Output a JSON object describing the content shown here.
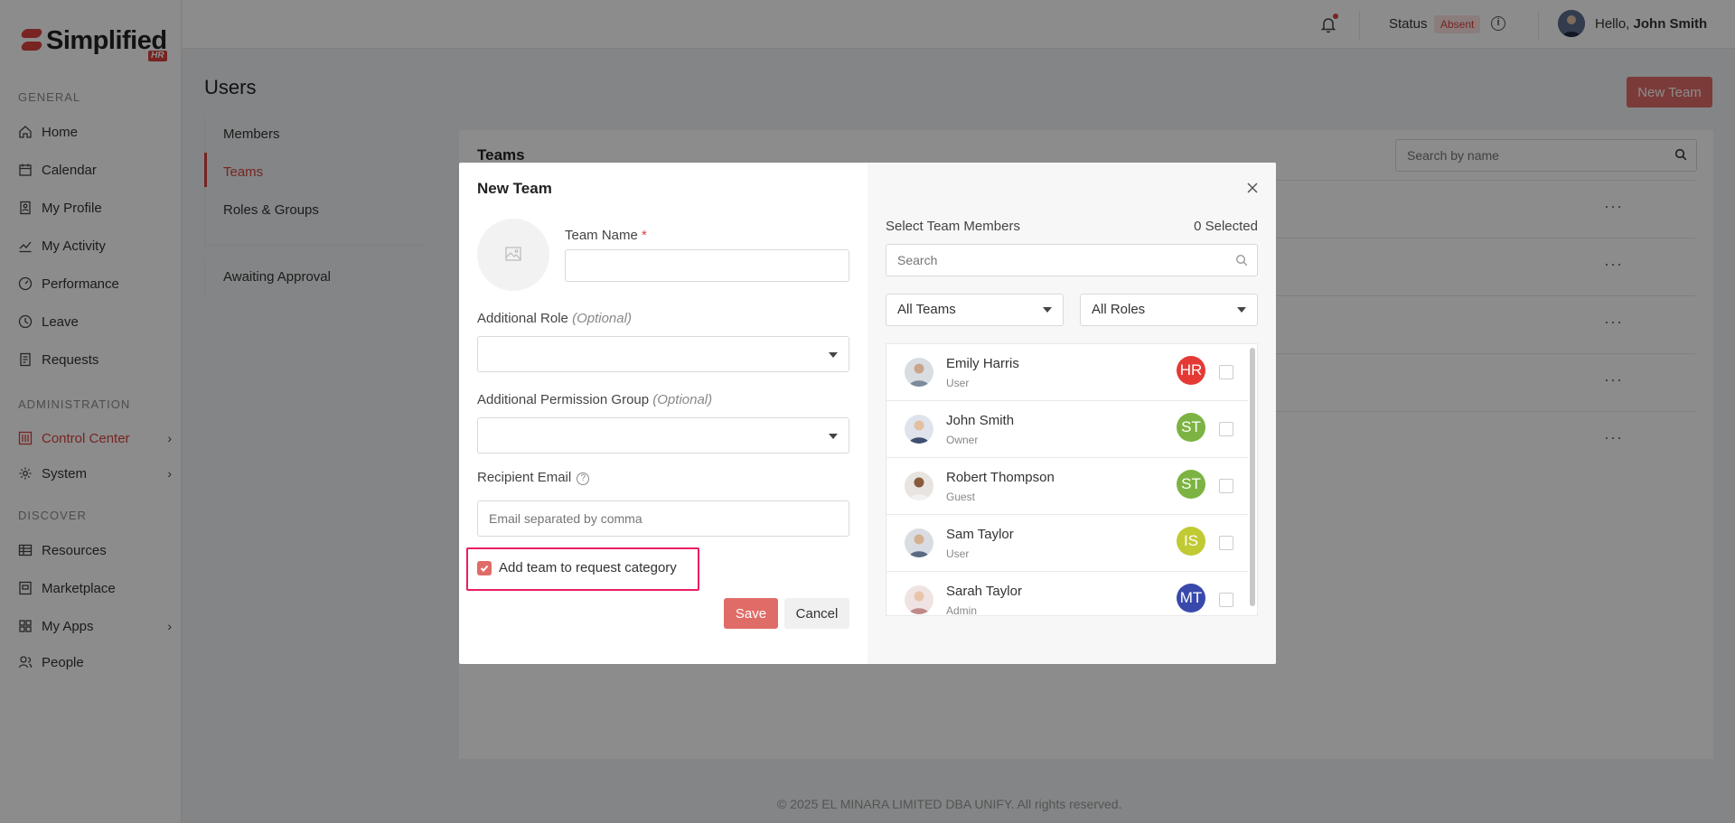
{
  "app": {
    "logo_text": "Simplified",
    "logo_badge": "HR"
  },
  "sidebar": {
    "sections": {
      "general": "GENERAL",
      "administration": "ADMINISTRATION",
      "discover": "DISCOVER"
    },
    "items": [
      {
        "label": "Home",
        "icon": "home-icon"
      },
      {
        "label": "Calendar",
        "icon": "calendar-icon"
      },
      {
        "label": "My Profile",
        "icon": "profile-icon"
      },
      {
        "label": "My Activity",
        "icon": "activity-icon"
      },
      {
        "label": "Performance",
        "icon": "gauge-icon"
      },
      {
        "label": "Leave",
        "icon": "clock-icon"
      },
      {
        "label": "Requests",
        "icon": "document-icon"
      },
      {
        "label": "Control Center",
        "icon": "control-icon",
        "active": true
      },
      {
        "label": "System",
        "icon": "gear-icon"
      },
      {
        "label": "Resources",
        "icon": "table-icon"
      },
      {
        "label": "Marketplace",
        "icon": "store-icon"
      },
      {
        "label": "My Apps",
        "icon": "apps-icon"
      },
      {
        "label": "People",
        "icon": "people-icon"
      }
    ]
  },
  "topbar": {
    "status_label": "Status",
    "status_value": "Absent",
    "greeting": "Hello,",
    "user_name": "John Smith"
  },
  "page": {
    "title": "Users",
    "new_team_button": "New Team",
    "subnav": [
      "Members",
      "Teams",
      "Roles & Groups"
    ],
    "subnav_extra": "Awaiting Approval",
    "panel_title": "Teams",
    "search_placeholder": "Search by name",
    "row_action": "···"
  },
  "footer": "© 2025 EL MINARA LIMITED DBA UNIFY. All rights reserved.",
  "modal": {
    "title": "New Team",
    "team_name_label": "Team Name",
    "required_mark": "*",
    "additional_role_label": "Additional Role",
    "additional_permission_label": "Additional Permission Group",
    "optional_text": "(Optional)",
    "recipient_email_label": "Recipient Email",
    "email_placeholder": "Email separated by comma",
    "checkbox_label": "Add team to request category",
    "checkbox_checked": true,
    "save_button": "Save",
    "cancel_button": "Cancel",
    "select_members_label": "Select Team Members",
    "selected_count": "0 Selected",
    "member_search_placeholder": "Search",
    "teams_filter": "All Teams",
    "roles_filter": "All Roles",
    "members": [
      {
        "name": "Emily Harris",
        "role": "User",
        "team": "HR",
        "team_color": "#e53935",
        "avatar_color": "#7a8a9a"
      },
      {
        "name": "John Smith",
        "role": "Owner",
        "team": "ST",
        "team_color": "#7cb342",
        "avatar_color": "#3e4f70"
      },
      {
        "name": "Robert Thompson",
        "role": "Guest",
        "team": "ST",
        "team_color": "#7cb342",
        "avatar_color": "#4a3a2a"
      },
      {
        "name": "Sam Taylor",
        "role": "User",
        "team": "IS",
        "team_color": "#c0ca33",
        "avatar_color": "#5a6a80"
      },
      {
        "name": "Sarah Taylor",
        "role": "Admin",
        "team": "MT",
        "team_color": "#3949ab",
        "avatar_color": "#c08a8a"
      }
    ]
  }
}
